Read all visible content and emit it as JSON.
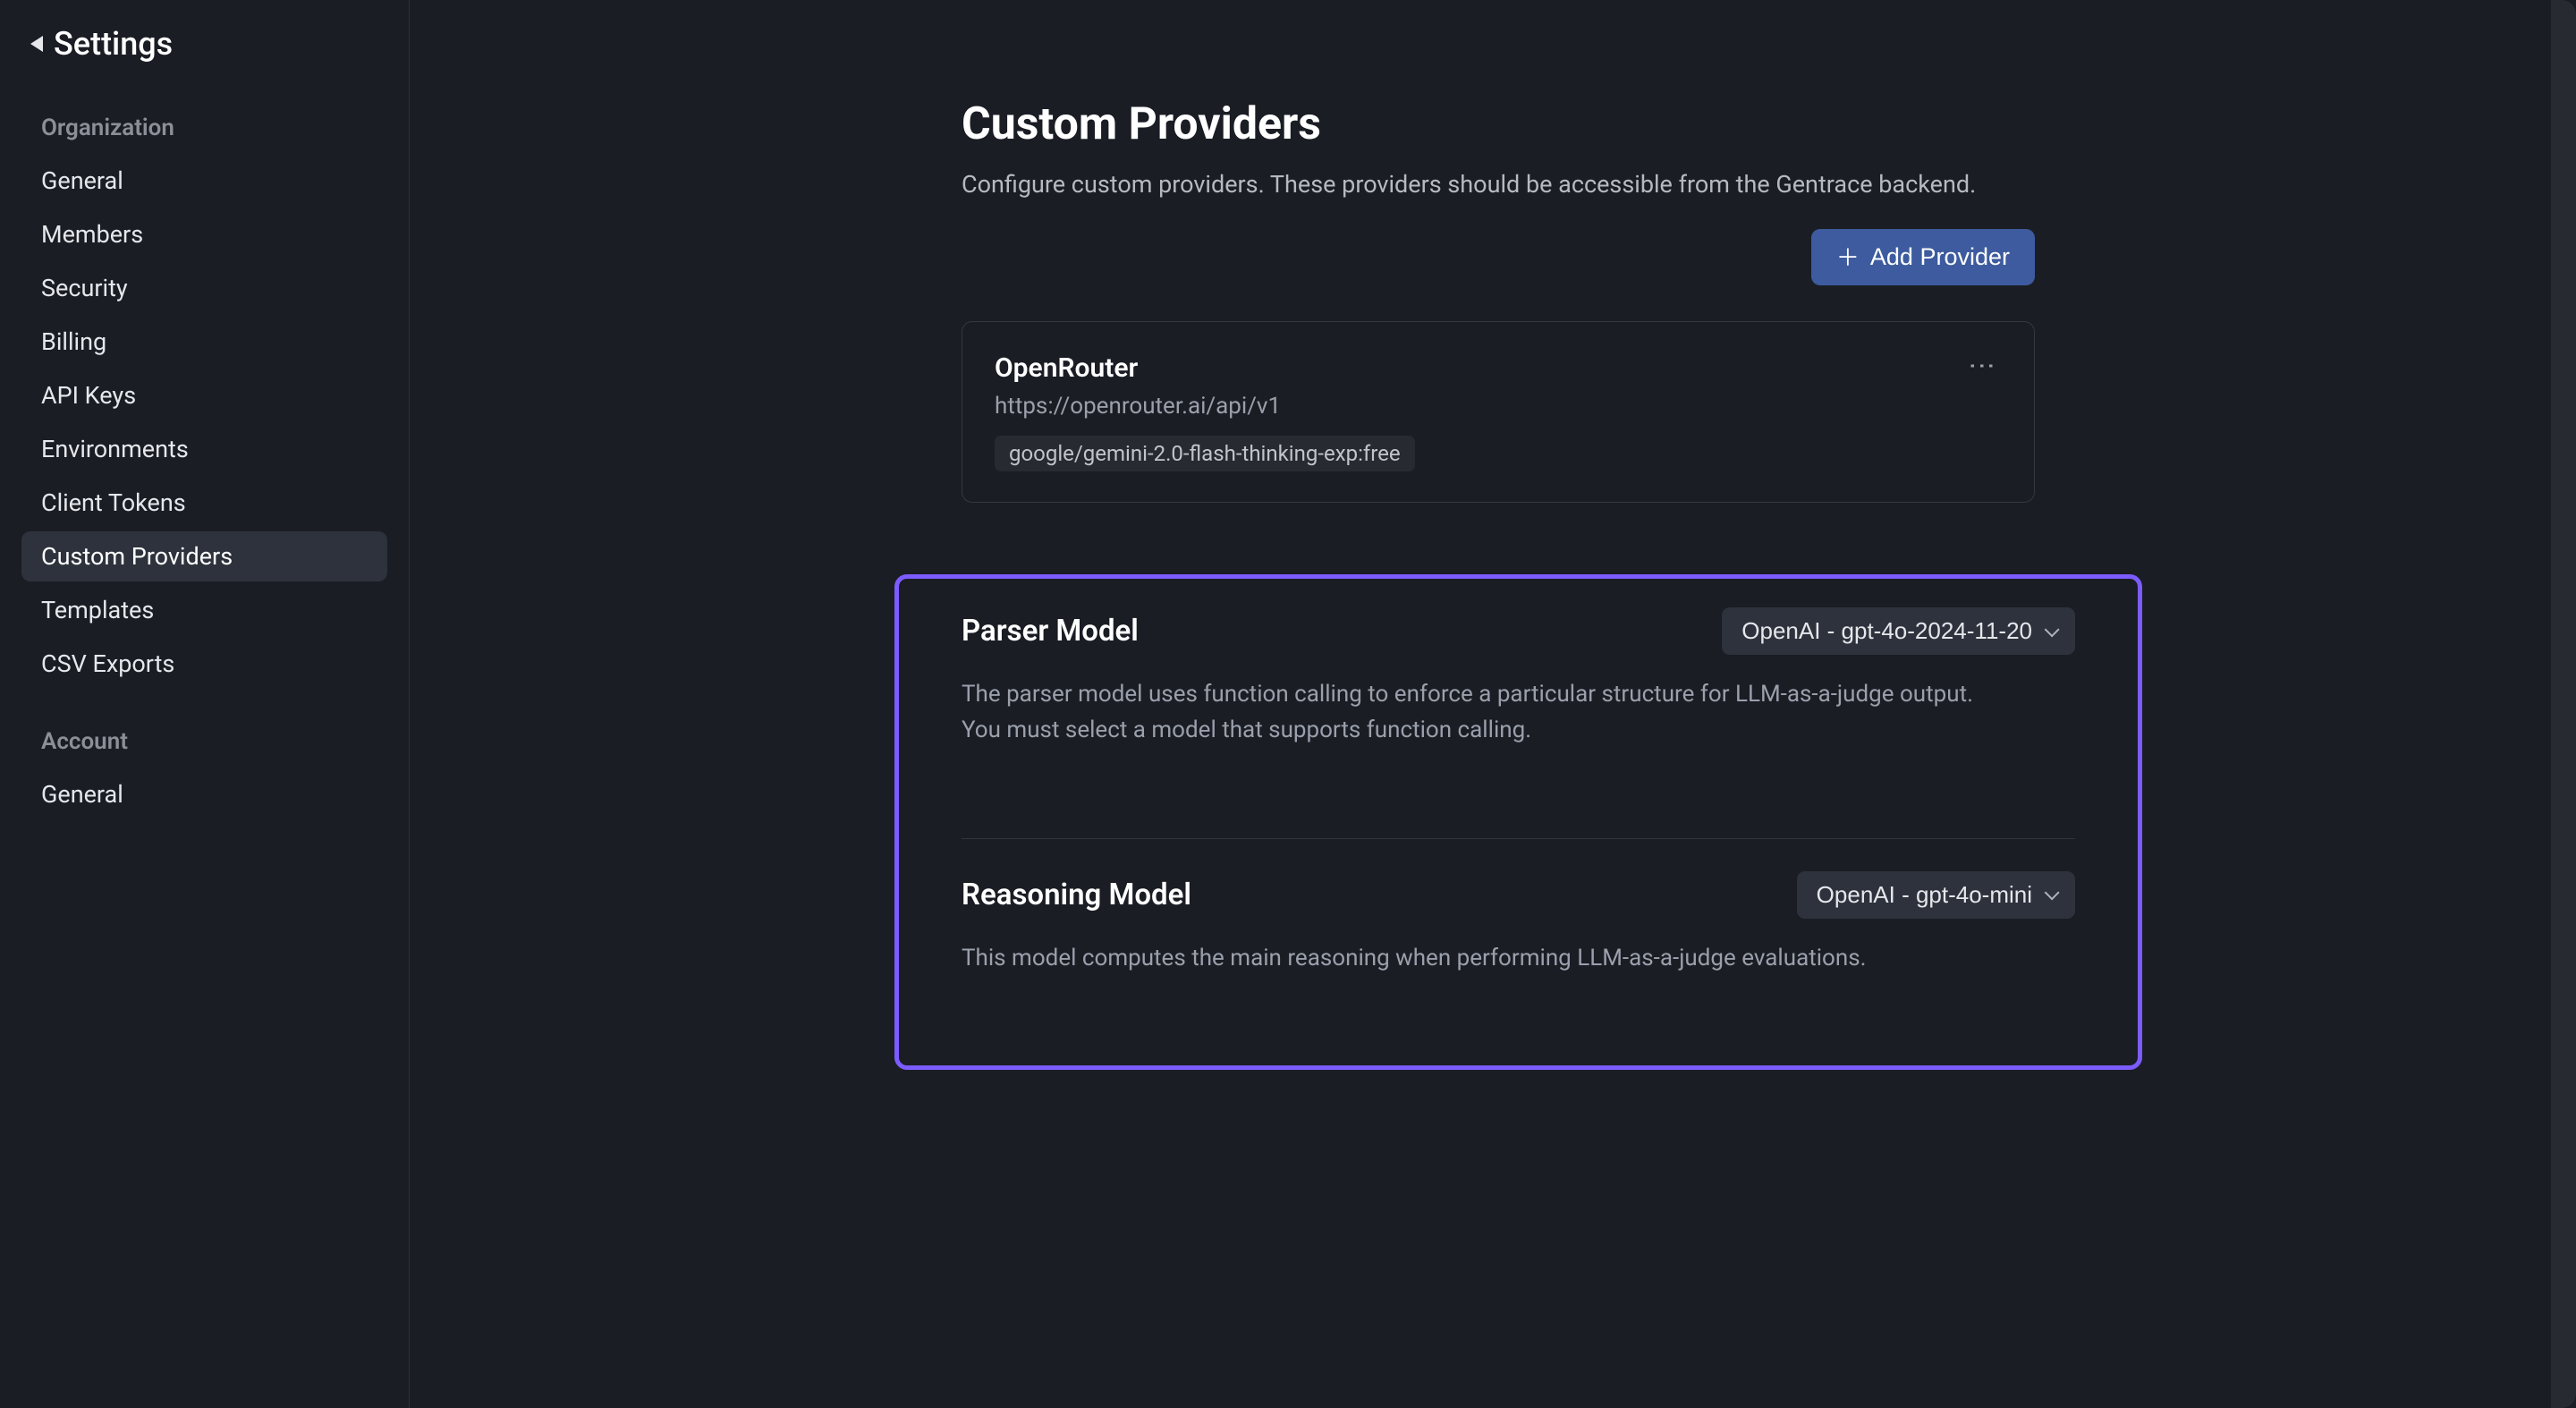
{
  "sidebar": {
    "back_label": "Settings",
    "sections": [
      {
        "key": "organization",
        "label": "Organization",
        "items": [
          {
            "key": "general-org",
            "label": "General"
          },
          {
            "key": "members",
            "label": "Members"
          },
          {
            "key": "security",
            "label": "Security"
          },
          {
            "key": "billing",
            "label": "Billing"
          },
          {
            "key": "api-keys",
            "label": "API Keys"
          },
          {
            "key": "environments",
            "label": "Environments"
          },
          {
            "key": "client-tokens",
            "label": "Client Tokens"
          },
          {
            "key": "custom-providers",
            "label": "Custom Providers",
            "active": true
          },
          {
            "key": "templates",
            "label": "Templates"
          },
          {
            "key": "csv-exports",
            "label": "CSV Exports"
          }
        ]
      },
      {
        "key": "account",
        "label": "Account",
        "items": [
          {
            "key": "general-account",
            "label": "General"
          }
        ]
      }
    ]
  },
  "main": {
    "title": "Custom Providers",
    "description": "Configure custom providers. These providers should be accessible from the Gentrace backend.",
    "add_button_label": "Add Provider",
    "provider": {
      "name": "OpenRouter",
      "url": "https://openrouter.ai/api/v1",
      "model_tag": "google/gemini-2.0-flash-thinking-exp:free"
    },
    "parser_model": {
      "title": "Parser Model",
      "selected": "OpenAI - gpt-4o-2024-11-20",
      "description": "The parser model uses function calling to enforce a particular structure for LLM-as-a-judge output. You must select a model that supports function calling."
    },
    "reasoning_model": {
      "title": "Reasoning Model",
      "selected": "OpenAI - gpt-4o-mini",
      "description": "This model computes the main reasoning when performing LLM-as-a-judge evaluations."
    }
  }
}
